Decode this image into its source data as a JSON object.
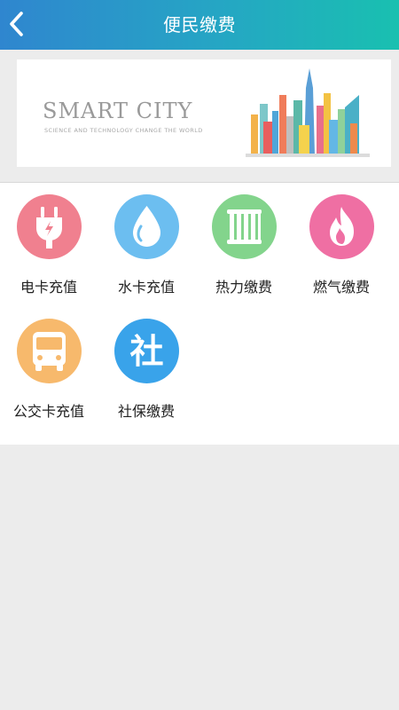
{
  "header": {
    "title": "便民缴费",
    "back_icon": "chevron-left-icon"
  },
  "banner": {
    "title": "SMART CITY",
    "subtitle": "SCIENCE AND TECHNOLOGY CHANGE THE WORLD"
  },
  "services": [
    {
      "label": "电卡充值",
      "icon": "plug-icon",
      "color": "#f0808f"
    },
    {
      "label": "水卡充值",
      "icon": "water-drop-icon",
      "color": "#6cbef0"
    },
    {
      "label": "热力缴费",
      "icon": "radiator-icon",
      "color": "#83d48c"
    },
    {
      "label": "燃气缴费",
      "icon": "flame-icon",
      "color": "#ef6fa3"
    },
    {
      "label": "公交卡充值",
      "icon": "bus-icon",
      "color": "#f7b96c"
    },
    {
      "label": "社保缴费",
      "icon": "social-security-icon",
      "color": "#39a3ea",
      "glyph": "社"
    }
  ],
  "colors": {
    "header_start": "#2f86cf",
    "header_end": "#19c0b0",
    "background": "#ececec"
  }
}
